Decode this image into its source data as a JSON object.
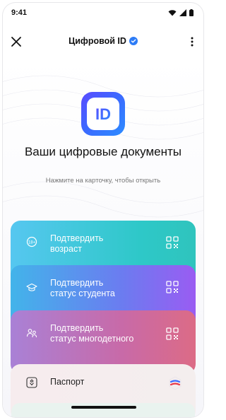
{
  "status_bar": {
    "time": "9:41"
  },
  "header": {
    "title": "Цифровой ID"
  },
  "logo": {
    "text": "ID"
  },
  "main": {
    "headline": "Ваши цифровые документы",
    "subtext": "Нажмите на карточку, чтобы открыть"
  },
  "cards": [
    {
      "label_line1": "Подтвердить",
      "label_line2": "возраст",
      "icon": "age-18-plus-icon",
      "color": "#2ec8c8"
    },
    {
      "label_line1": "Подтвердить",
      "label_line2": "статус студента",
      "icon": "graduation-cap-icon",
      "color": "#6b7cf0"
    },
    {
      "label_line1": "Подтвердить",
      "label_line2": "статус многодетного",
      "icon": "family-icon",
      "color": "#c86aa8"
    },
    {
      "label_line1": "Паспорт",
      "icon": "emblem-icon",
      "color": "#f4eeee"
    }
  ],
  "colors": {
    "accent": "#3b6bff",
    "verified_badge": "#2d7cf6"
  }
}
